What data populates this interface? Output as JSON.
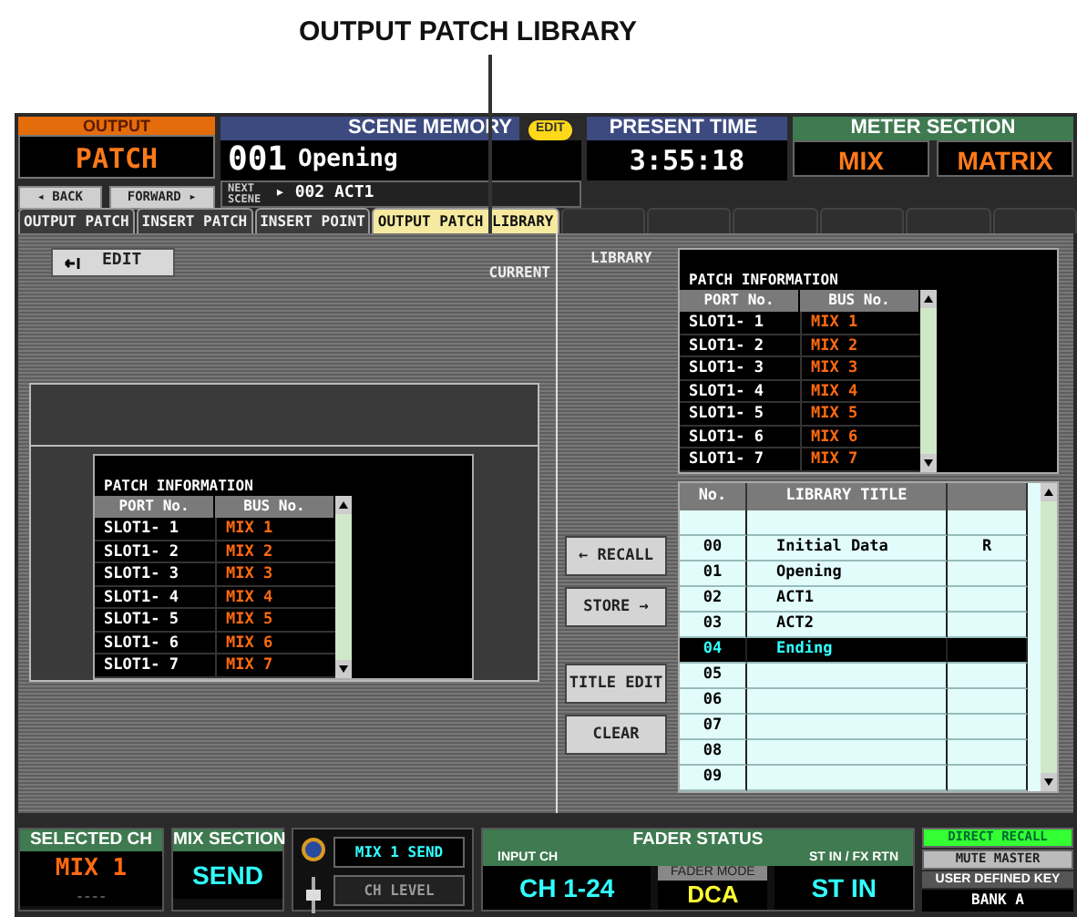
{
  "callout": {
    "label": "OUTPUT PATCH LIBRARY"
  },
  "header": {
    "function": {
      "title": "OUTPUT",
      "name": "PATCH",
      "back": "◂ BACK",
      "forward": "FORWARD ▸"
    },
    "scene_memory": {
      "title": "SCENE MEMORY",
      "badge": "EDIT",
      "number": "001",
      "name": "Opening",
      "next_label": "NEXT SCENE",
      "next": "▸ 002 ACT1"
    },
    "present_time": {
      "title": "PRESENT TIME",
      "time": "3:55:18"
    },
    "meter_section": {
      "title": "METER SECTION",
      "buttons": [
        "MIX",
        "MATRIX"
      ]
    }
  },
  "tabs": [
    {
      "label": "OUTPUT PATCH",
      "selected": false
    },
    {
      "label": "INSERT PATCH",
      "selected": false
    },
    {
      "label": "INSERT POINT",
      "selected": false
    },
    {
      "label": "OUTPUT PATCH LIBRARY",
      "selected": true
    }
  ],
  "current": {
    "edit_button": "EDIT",
    "label": "CURRENT",
    "patch": {
      "title": "PATCH INFORMATION",
      "columns": [
        "PORT No.",
        "BUS No."
      ],
      "rows": [
        {
          "port": "SLOT1- 1",
          "bus": "MIX 1"
        },
        {
          "port": "SLOT1- 2",
          "bus": "MIX 2"
        },
        {
          "port": "SLOT1- 3",
          "bus": "MIX 3"
        },
        {
          "port": "SLOT1- 4",
          "bus": "MIX 4"
        },
        {
          "port": "SLOT1- 5",
          "bus": "MIX 5"
        },
        {
          "port": "SLOT1- 6",
          "bus": "MIX 6"
        },
        {
          "port": "SLOT1- 7",
          "bus": "MIX 7"
        }
      ]
    }
  },
  "library": {
    "label": "LIBRARY",
    "patch": {
      "title": "PATCH INFORMATION",
      "columns": [
        "PORT No.",
        "BUS No."
      ],
      "rows": [
        {
          "port": "SLOT1- 1",
          "bus": "MIX 1"
        },
        {
          "port": "SLOT1- 2",
          "bus": "MIX 2"
        },
        {
          "port": "SLOT1- 3",
          "bus": "MIX 3"
        },
        {
          "port": "SLOT1- 4",
          "bus": "MIX 4"
        },
        {
          "port": "SLOT1- 5",
          "bus": "MIX 5"
        },
        {
          "port": "SLOT1- 6",
          "bus": "MIX 6"
        },
        {
          "port": "SLOT1- 7",
          "bus": "MIX 7"
        }
      ]
    },
    "buttons": [
      "← RECALL",
      "STORE →",
      "TITLE EDIT",
      "CLEAR"
    ],
    "table": {
      "columns": [
        "No.",
        "LIBRARY TITLE"
      ],
      "rows": [
        {
          "no": "00",
          "title": "Initial Data",
          "flag": "R",
          "selected": false
        },
        {
          "no": "01",
          "title": "Opening",
          "selected": false
        },
        {
          "no": "02",
          "title": "ACT1",
          "selected": false
        },
        {
          "no": "03",
          "title": "ACT2",
          "selected": false
        },
        {
          "no": "04",
          "title": "Ending",
          "selected": true
        },
        {
          "no": "05",
          "selected": false
        },
        {
          "no": "06",
          "selected": false
        },
        {
          "no": "07",
          "selected": false
        },
        {
          "no": "08",
          "selected": false
        },
        {
          "no": "09",
          "selected": false
        }
      ]
    }
  },
  "bottom": {
    "selected_ch": {
      "title": "SELECTED CH",
      "value": "MIX 1",
      "sub": "----"
    },
    "mix_section": {
      "title": "MIX SECTION",
      "value": "SEND"
    },
    "send_buttons": [
      {
        "label": "MIX 1 SEND",
        "selected": true
      },
      {
        "label": "CH LEVEL",
        "selected": false
      }
    ],
    "fader_status": {
      "title": "FADER STATUS",
      "input_label": "INPUT CH",
      "input_value": "CH 1-24",
      "mode_label": "FADER MODE",
      "mode_value": "DCA",
      "st_label": "ST IN / FX RTN",
      "st_value": "ST IN"
    },
    "keys": [
      {
        "label": "DIRECT RECALL",
        "selected": true
      },
      {
        "label": "MUTE MASTER",
        "selected": false
      }
    ],
    "user_key": {
      "title": "USER DEFINED KEY",
      "bank": "BANK A"
    }
  }
}
